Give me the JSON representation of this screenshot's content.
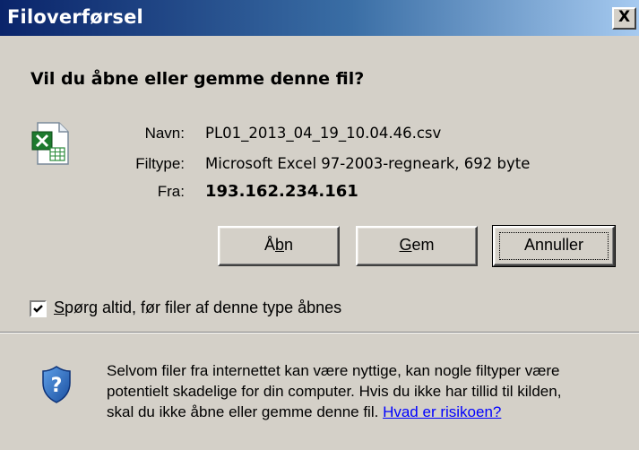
{
  "window": {
    "title": "Filoverførsel",
    "close_label": "X"
  },
  "dialog": {
    "heading": "Vil du åbne eller gemme denne fil?",
    "icon": "excel-file-icon",
    "fields": {
      "name_label": "Navn:",
      "name_value": "PL01_2013_04_19_10.04.46.csv",
      "type_label": "Filtype:",
      "type_value": "Microsoft Excel 97-2003-regneark, 692 byte",
      "from_label": "Fra:",
      "from_value": "193.162.234.161"
    },
    "buttons": {
      "open": {
        "pre": "Å",
        "hotkey": "b",
        "post": "n"
      },
      "save": {
        "pre": "",
        "hotkey": "G",
        "post": "em"
      },
      "cancel": "Annuller"
    },
    "checkbox": {
      "checked": true,
      "hotkey": "S",
      "label_rest": "pørg altid, før filer af denne type åbnes"
    },
    "warning": {
      "icon": "shield-question-icon",
      "line1": "Selvom filer fra internettet kan være nyttige, kan nogle filtyper være",
      "line2": "potentielt skadelige for din computer. Hvis du ikke har tillid til kilden,",
      "line3": "skal du ikke åbne eller gemme denne fil.",
      "link": "Hvad er risikoen?"
    }
  },
  "colors": {
    "dialog_bg": "#d4d0c8",
    "titlebar_start": "#0a246a",
    "titlebar_end": "#a6caf0",
    "link": "#0000ff",
    "shield": "#1f5fb8"
  }
}
